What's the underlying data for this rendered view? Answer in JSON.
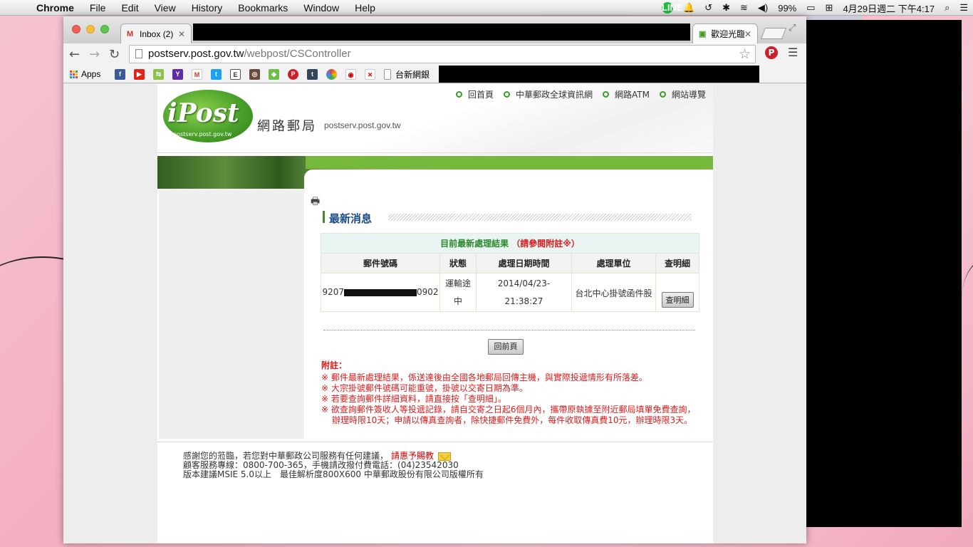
{
  "menubar": {
    "app": "Chrome",
    "menus": [
      "File",
      "Edit",
      "View",
      "History",
      "Bookmarks",
      "Window",
      "Help"
    ],
    "battery": "99%",
    "datetime": "4月29日週二 下午4:17",
    "line_label": "LINE"
  },
  "browser": {
    "tabs": [
      {
        "title": "Inbox (2)",
        "favicon": "gmail-icon"
      },
      {
        "title": "歡迎光臨",
        "favicon": "site-icon"
      }
    ],
    "url": {
      "host": "postserv.post.gov.tw",
      "path": "/webpost/CSController"
    },
    "bookmarks": {
      "apps_label": "Apps",
      "last_label": "台新網銀"
    }
  },
  "site": {
    "logo_text": "iPost",
    "logo_sub": "postserv.post.gov.tw",
    "title": "網路郵局",
    "domain": "postserv.post.gov.tw",
    "nav": [
      "回首頁",
      "中華郵政全球資訊網",
      "網路ATM",
      "網站導覽"
    ]
  },
  "news": {
    "title": "最新消息",
    "caption": "目前最新處理結果",
    "caption_note": "（請參閱附註※）",
    "headers": [
      "郵件號碼",
      "狀態",
      "處理日期時間",
      "處理單位",
      "查明細"
    ],
    "row": {
      "number_prefix": "9207",
      "number_suffix": "0902",
      "status_1": "運輸途",
      "status_2": "中",
      "date_1": "2014/04/23-",
      "date_2": "21:38:27",
      "unit": "台北中心掛號函件股",
      "detail_button": "查明細"
    },
    "home_button": "回前頁"
  },
  "notes": {
    "heading": "附註：",
    "items": [
      "※ 郵件最新處理結果，係送達後由全國各地郵局回傳主機，與實際投遞情形有所落差。",
      "※ 大宗掛號郵件號碼可能重號，掛號以交寄日期為準。",
      "※ 若要查詢郵件詳細資料，請直接按「查明細」。",
      "※ 欲查詢郵件簽收人等投遞記錄，請自交寄之日起6個月內，攜帶原執據至附近郵局填單免費查詢，辦理時限10天；申請以傳真查詢者，除快捷郵件免費外，每件收取傳真費10元，辦理時限3天。"
    ]
  },
  "footer": {
    "line1": "感謝您的蒞臨，若您對中華郵政公司服務有任何建議，",
    "line1_link": "請惠予賜教",
    "line2": "顧客服務專線：0800-700-365，手機請改撥付費電話：(04)23542030",
    "line3": "版本建議MSIE 5.0以上　最佳解析度800X600 中華郵政股份有限公司版權所有"
  }
}
